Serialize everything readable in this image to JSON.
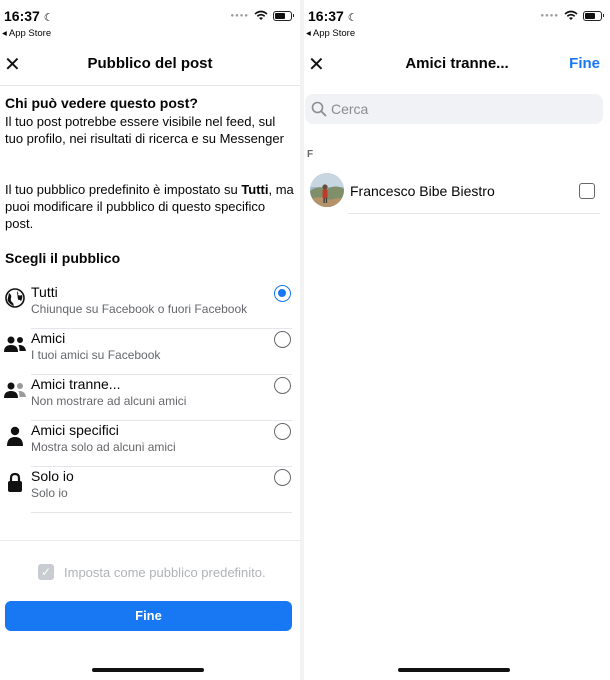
{
  "left": {
    "status": {
      "time": "16:37",
      "back_app": "◂ App Store"
    },
    "nav": {
      "title": "Pubblico del post"
    },
    "question": {
      "title": "Chi può vedere questo post?",
      "desc": "Il tuo post potrebbe essere visibile nel feed, sul tuo profilo, nei risultati di ricerca e su Messenger",
      "default_pre": "Il tuo pubblico predefinito è impostato su ",
      "default_bold": "Tutti",
      "default_post": ", ma puoi modificare il pubblico di questo specifico post."
    },
    "choose_title": "Scegli il pubblico",
    "options": [
      {
        "label": "Tutti",
        "sub": "Chiunque su Facebook o fuori Facebook",
        "icon": "globe-icon",
        "selected": true
      },
      {
        "label": "Amici",
        "sub": "I tuoi amici su Facebook",
        "icon": "friends-icon",
        "selected": false
      },
      {
        "label": "Amici tranne...",
        "sub": "Non mostrare ad alcuni amici",
        "icon": "friends-except-icon",
        "selected": false
      },
      {
        "label": "Amici specifici",
        "sub": "Mostra solo ad alcuni amici",
        "icon": "person-icon",
        "selected": false
      },
      {
        "label": "Solo io",
        "sub": "Solo io",
        "icon": "lock-icon",
        "selected": false
      }
    ],
    "set_default_label": "Imposta come pubblico predefinito.",
    "done_button": "Fine"
  },
  "right": {
    "status": {
      "time": "16:37",
      "back_app": "◂ App Store"
    },
    "nav": {
      "title": "Amici tranne...",
      "done": "Fine"
    },
    "search_placeholder": "Cerca",
    "section_letter": "F",
    "friends": [
      {
        "name": "Francesco Bibe Biestro",
        "checked": false
      }
    ]
  },
  "colors": {
    "accent": "#1877f2",
    "secondary_text": "#65676b",
    "disabled": "#b0b3b8"
  }
}
